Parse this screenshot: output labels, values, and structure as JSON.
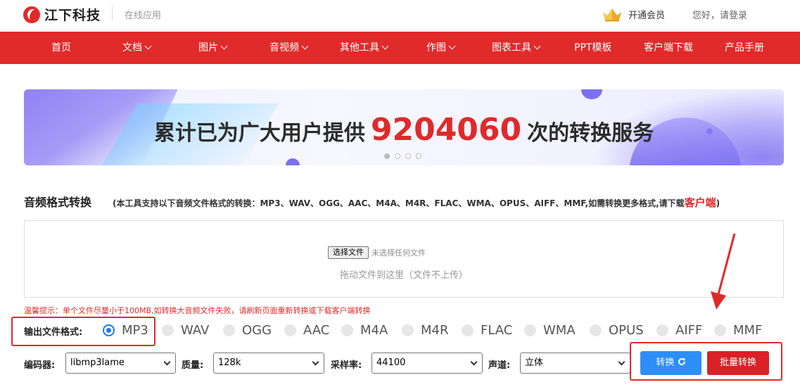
{
  "header": {
    "brand": "江下科技",
    "subtitle": "在线应用",
    "vip_label": "开通会员",
    "login_text": "您好，请登录"
  },
  "nav": {
    "items": [
      {
        "label": "首页",
        "has_dropdown": false
      },
      {
        "label": "文档",
        "has_dropdown": true
      },
      {
        "label": "图片",
        "has_dropdown": true
      },
      {
        "label": "音视频",
        "has_dropdown": true
      },
      {
        "label": "其他工具",
        "has_dropdown": true
      },
      {
        "label": "作图",
        "has_dropdown": true
      },
      {
        "label": "图表工具",
        "has_dropdown": true
      },
      {
        "label": "PPT模板",
        "has_dropdown": false
      },
      {
        "label": "客户端下载",
        "has_dropdown": false
      },
      {
        "label": "产品手册",
        "has_dropdown": false
      }
    ]
  },
  "banner": {
    "text_before": "累计已为广大用户提供",
    "count": "9204060",
    "text_after": "次的转换服务",
    "slide_count": 4,
    "active_slide": 1
  },
  "section": {
    "title": "音频格式转换",
    "note": "(本工具支持以下音频文件格式的转换：MP3、WAV、OGG、AAC、M4A、M4R、FLAC、WMA、OPUS、AIFF、MMF,如需转换更多格式,请下载",
    "note_link": "客户端",
    "note_end": ")"
  },
  "upload": {
    "choose_button": "选择文件",
    "no_file_text": "未选择任何文件",
    "drop_hint": "拖动文件到这里（文件不上传）"
  },
  "tip": "温馨提示：单个文件尽量小于100MB,如转换大音频文件失败，请刷新页面重新转换或下载客户端转换",
  "output_format": {
    "label": "输出文件格式:",
    "selected": "MP3",
    "options": [
      "MP3",
      "WAV",
      "OGG",
      "AAC",
      "M4A",
      "M4R",
      "FLAC",
      "WMA",
      "OPUS",
      "AIFF",
      "MMF"
    ]
  },
  "settings": {
    "encoder": {
      "label": "编码器:",
      "value": "libmp3lame"
    },
    "quality": {
      "label": "质量:",
      "value": "128k"
    },
    "sample_rate": {
      "label": "采样率:",
      "value": "44100"
    },
    "channel": {
      "label": "声道:",
      "value": "立体"
    }
  },
  "actions": {
    "convert": "转换",
    "batch_convert": "批量转换"
  },
  "colors": {
    "brand_red": "#e12a2a",
    "button_blue": "#2c8ef8",
    "button_red": "#d92127",
    "radio_blue": "#1a7cf0"
  }
}
